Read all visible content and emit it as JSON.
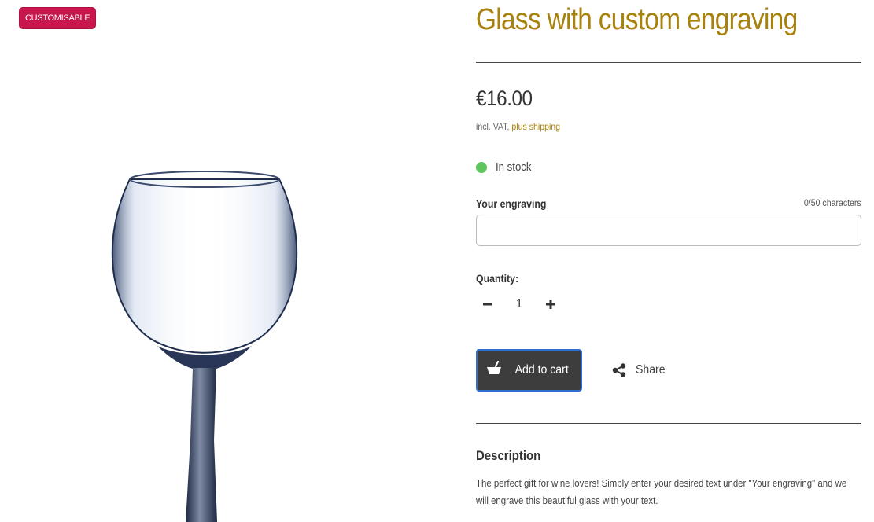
{
  "badge": {
    "label": "CUSTOMISABLE",
    "color": "#c8174d"
  },
  "product": {
    "title": "Glass with custom engraving",
    "price": "€16.00",
    "tax_prefix": "incl. VAT, ",
    "shipping_link": "plus shipping",
    "stock_label": "In stock",
    "stock_color": "#5ec45e",
    "accent_color": "#a8820c"
  },
  "engraving": {
    "label": "Your engraving",
    "counter": "0/50 characters",
    "value": "",
    "placeholder": ""
  },
  "quantity": {
    "label": "Quantity:",
    "value": "1",
    "minus_icon": "minus-icon",
    "plus_icon": "plus-icon"
  },
  "actions": {
    "add_to_cart": "Add to cart",
    "add_to_cart_icon": "basket-icon",
    "share": "Share",
    "share_icon": "share-icon"
  },
  "description": {
    "heading": "Description",
    "text": "The perfect gift for wine lovers! Simply enter your desired text under \"Your engraving\" and we will engrave this beautiful glass with your text."
  }
}
